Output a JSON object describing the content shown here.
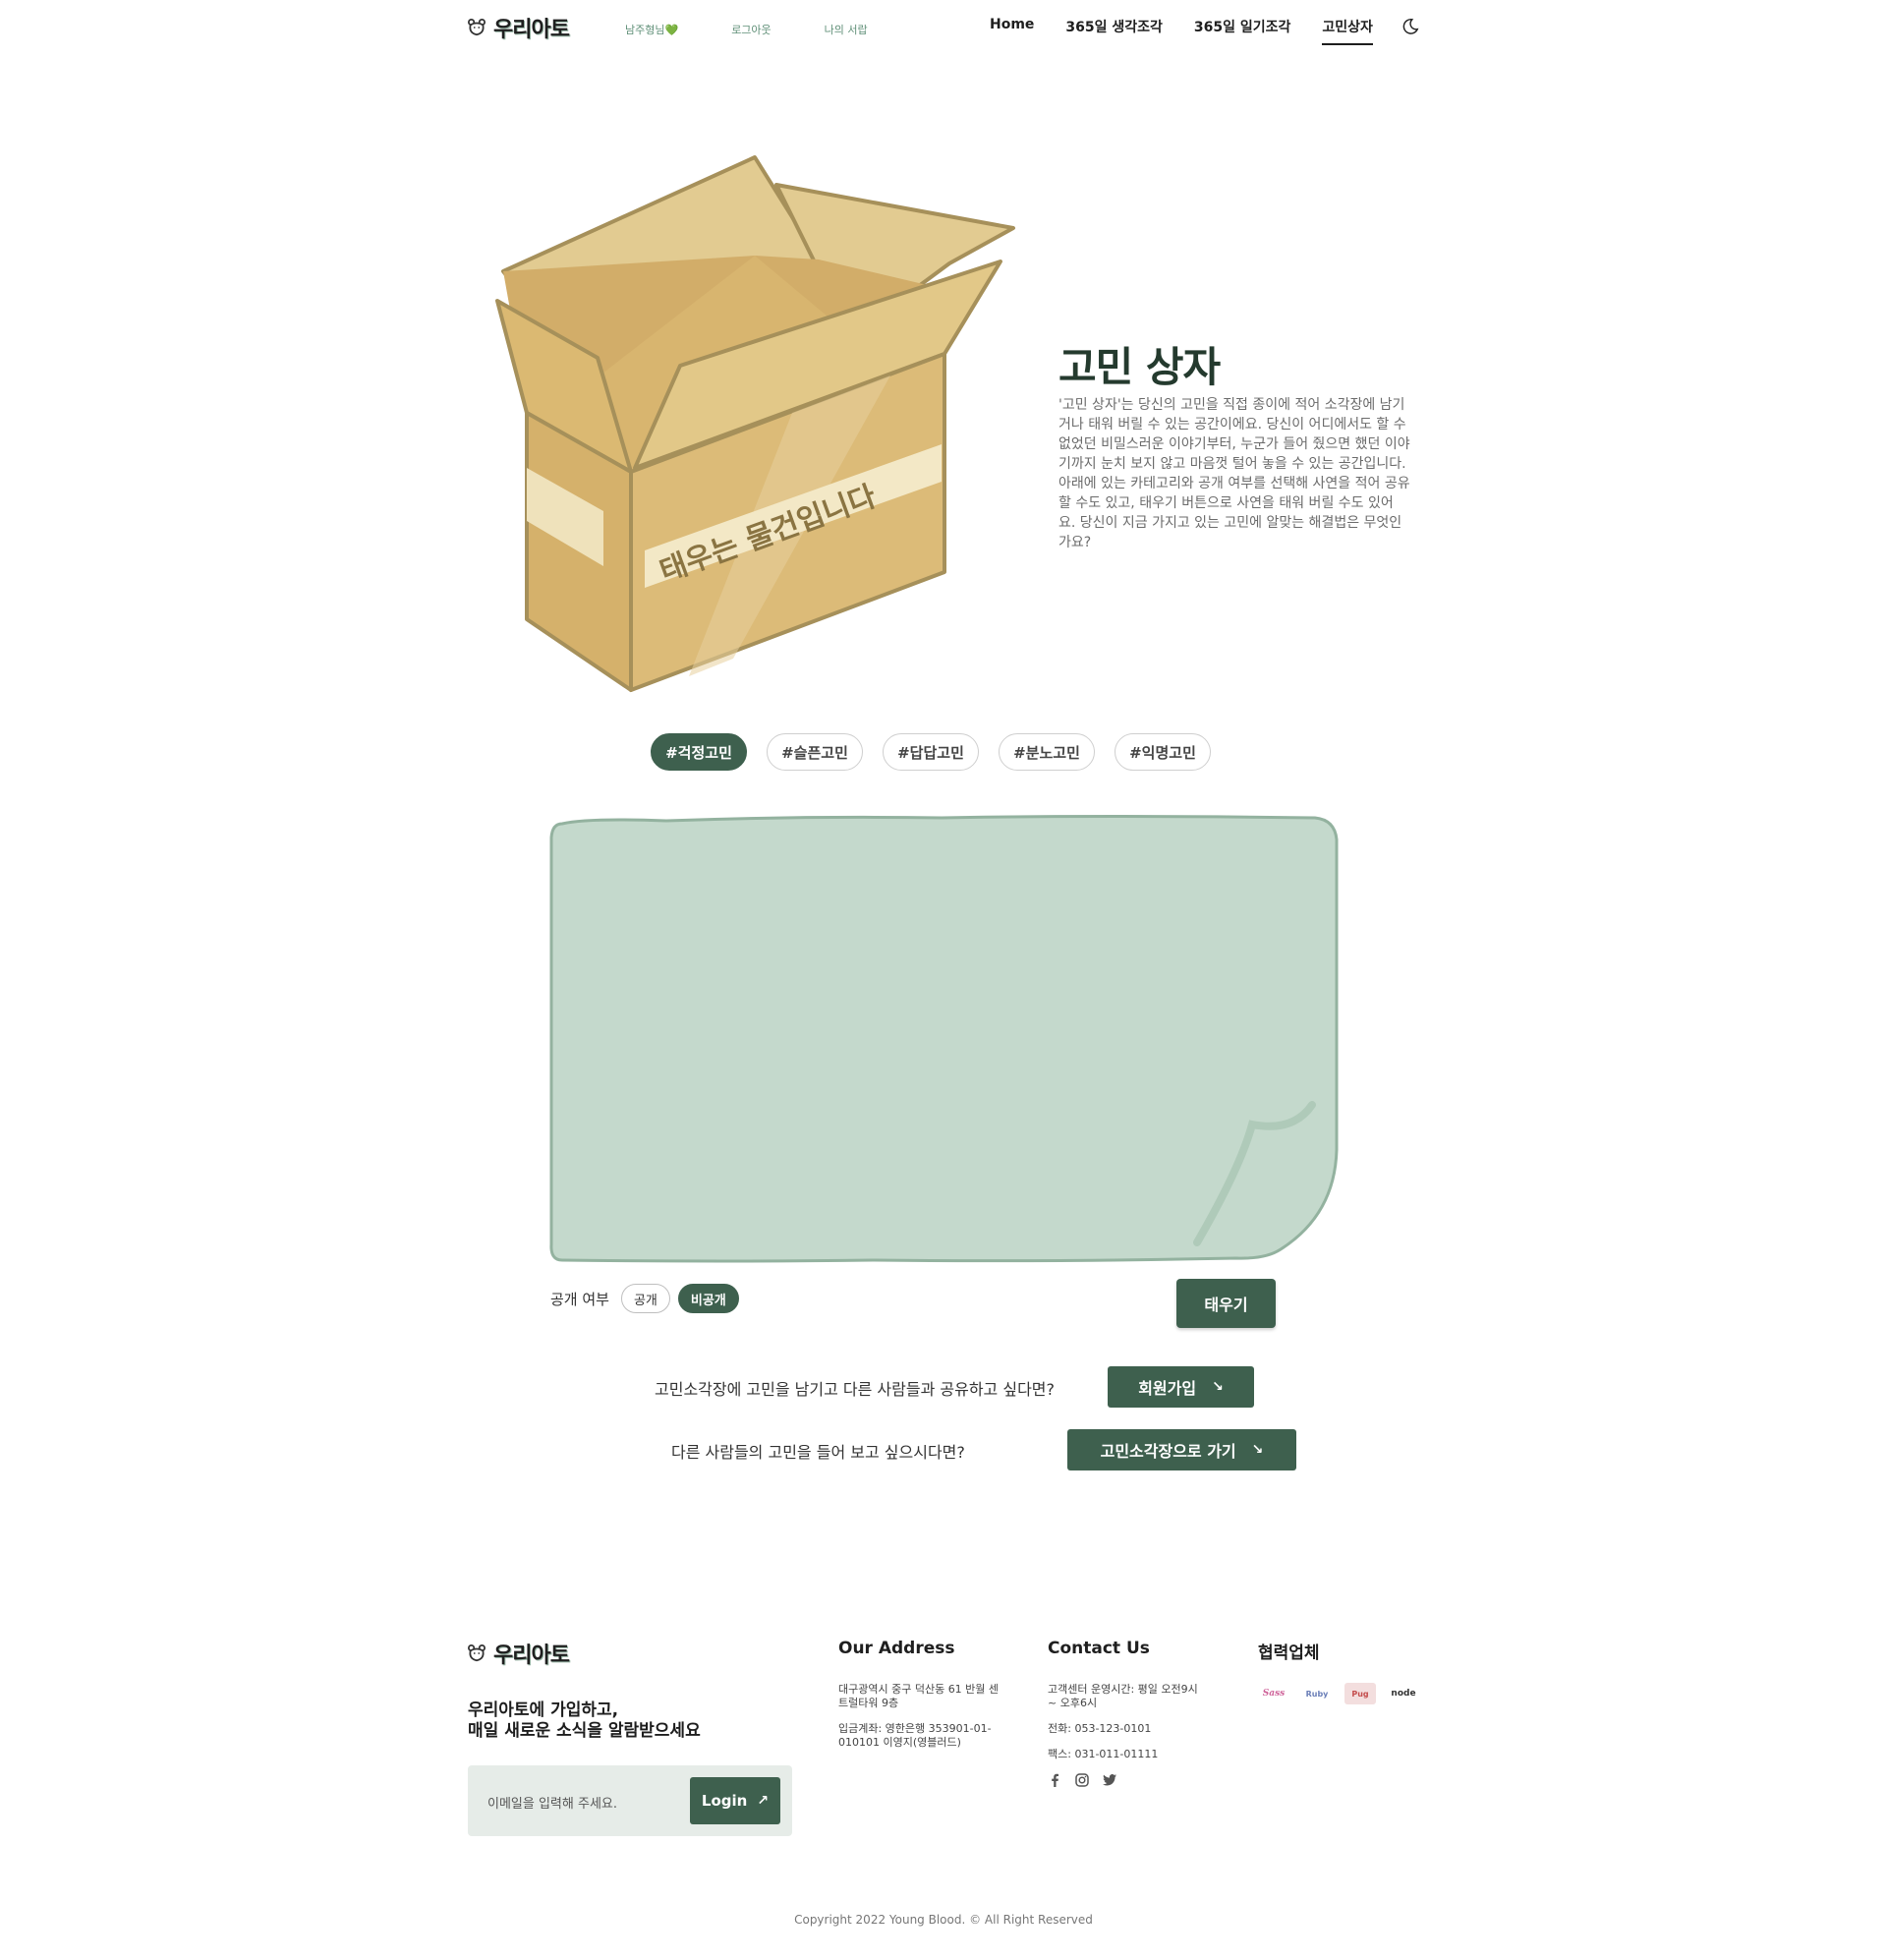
{
  "header": {
    "logo": "우리아토",
    "user_links": [
      "남주형님💚",
      "로그아웃",
      "나의 서랍"
    ],
    "nav": [
      "Home",
      "365일 생각조각",
      "365일 일기조각",
      "고민상자"
    ],
    "active_nav": "고민상자"
  },
  "hero": {
    "title": "고민 상자",
    "description": "'고민 상자'는 당신의 고민을 직접 종이에 적어 소각장에 남기거나 태워 버릴 수 있는 공간이에요. 당신이 어디에서도 할 수 없었던 비밀스러운 이야기부터, 누군가 들어 줬으면 했던 이야기까지 눈치 보지 않고 마음껏 털어 놓을 수 있는 공간입니다. 아래에 있는 카테고리와 공개 여부를 선택해 사연을 적어 공유할 수도 있고, 태우기 버튼으로 사연을 태워 버릴 수도 있어요. 당신이 지금 가지고 있는 고민에 알맞는 해결법은 무엇인가요?",
    "box_tape_text": "태우는 물건입니다"
  },
  "tags": [
    "#걱정고민",
    "#슬픈고민",
    "#답답고민",
    "#분노고민",
    "#익명고민"
  ],
  "active_tag": "#걱정고민",
  "visibility": {
    "label": "공개 여부",
    "options": [
      "공개",
      "비공개"
    ],
    "selected": "비공개"
  },
  "burn_button": "태우기",
  "cta": {
    "signup_text": "고민소각장에 고민을 남기고 다른 사람들과 공유하고 싶다면?",
    "signup_button": "회원가입",
    "browse_text": "다른 사람들의 고민을 들어 보고 싶으시다면?",
    "browse_button": "고민소각장으로 가기"
  },
  "footer": {
    "logo": "우리아토",
    "tagline_1": "우리아토에 가입하고,",
    "tagline_2": "매일 새로운 소식을 알람받으세요",
    "email_placeholder": "이메일을 입력해 주세요.",
    "login_button": "Login",
    "address_title": "Our Address",
    "address": "대구광역시 중구 덕산동 61 반월 센트럴타워 9층",
    "account": "입금계좌: 영한은행 353901-01-010101 이영지(영블러드)",
    "contact_title": "Contact Us",
    "hours": "고객센터 운영시간: 평일 오전9시 ~ 오후6시",
    "phone": "전화: 053-123-0101",
    "fax": "팩스: 031-011-01111",
    "partners_title": "협력업체",
    "partners": [
      "Sass",
      "Ruby",
      "Pug",
      "node"
    ],
    "copyright": "Copyright 2022 Young Blood. © All Right Reserved"
  },
  "colors": {
    "accent": "#3e604e",
    "paper": "#c4d9cc",
    "paper_border": "#93b29f",
    "box": "#dcbb78",
    "box_dark": "#a6905a"
  },
  "icons": [
    "bear-logo-icon",
    "moon-icon",
    "arrow-down-right-icon",
    "arrow-up-right-icon",
    "facebook-icon",
    "instagram-icon",
    "twitter-icon"
  ]
}
